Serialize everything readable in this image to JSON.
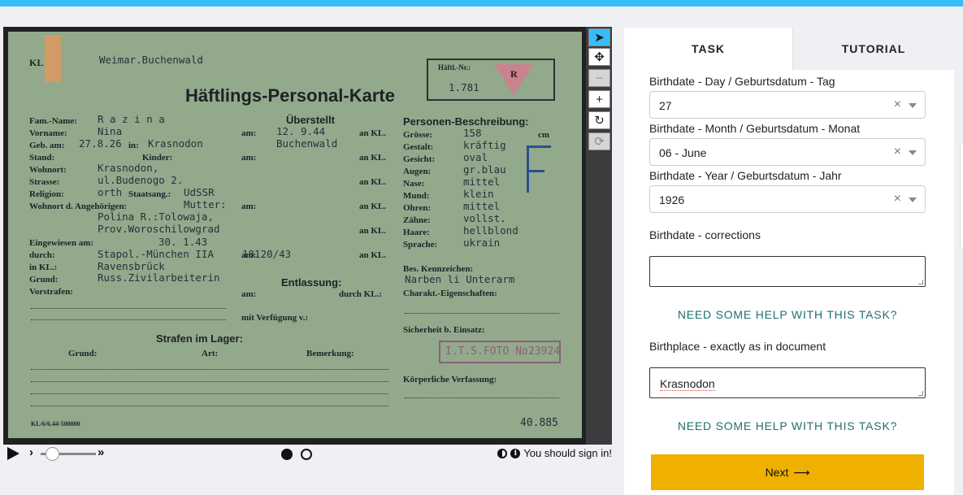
{
  "viewer": {
    "card": {
      "camp": "Weimar.Buchenwald",
      "kl": "KL",
      "hnr_label": "Häftl.-Nr.:",
      "hnr_value": "1.781",
      "triangle_letter": "R",
      "title": "Häftlings-Personal-Karte",
      "fam_name_label": "Fam.-Name:",
      "fam_name": "R a z i n a",
      "vorname_label": "Vorname:",
      "vorname": "Nina",
      "geb_label": "Geb. am:",
      "geb_value": "27.8.26",
      "in_label": "in:",
      "geb_place": "Krasnodon",
      "stand_label": "Stand:",
      "kinder_label": "Kinder:",
      "wohnort_label": "Wohnort:",
      "wohnort": "Krasnodon,",
      "strasse_label": "Strasse:",
      "strasse": "ul.Budenogo 2.",
      "religion_label": "Religion:",
      "religion": "orth",
      "staatsang_label": "Staatsang.:",
      "staatsang": "UdSSR",
      "angehoerige_label": "Wohnort d. Angehörigen:",
      "angehoerige_1": "Mutter:",
      "angehoerige_2": "Polina R.:Tolowaja,",
      "angehoerige_3": "Prov.Woroschilowgrad",
      "eingewiesen_label": "Eingewiesen am:",
      "eingewiesen": "30. 1.43",
      "durch_label": "durch:",
      "durch": "Stapol.-München IIA",
      "durch_nr": "18120/43",
      "inkl_label": "in KL.:",
      "inkl": "Ravensbrück",
      "grund_label": "Grund:",
      "grund": "Russ.Zivilarbeiterin",
      "vorstrafen_label": "Vorstrafen:",
      "ueberstellt_label": "Überstellt",
      "am_label": "am:",
      "ankl_label": "an KL.",
      "ueberstellt_date": "12. 9.44",
      "ueberstellt_place": "Buchenwald",
      "entlassung_label": "Entlassung:",
      "durchkl_label": "durch KL.:",
      "verfuegung_label": "mit Verfügung v.:",
      "personen_label": "Personen-Beschreibung:",
      "groesse_label": "Grösse:",
      "groesse": "158",
      "cm_label": "cm",
      "gestalt_label": "Gestalt:",
      "gestalt": "kräftig",
      "gesicht_label": "Gesicht:",
      "gesicht": "oval",
      "augen_label": "Augen:",
      "augen": "gr.blau",
      "nase_label": "Nase:",
      "nase": "mittel",
      "mund_label": "Mund:",
      "mund": "klein",
      "ohren_label": "Ohren:",
      "ohren": "mittel",
      "zaehne_label": "Zähne:",
      "zaehne": "vollst.",
      "haare_label": "Haare:",
      "haare": "hellblond",
      "sprache_label": "Sprache:",
      "sprache": "ukrain",
      "kennzeichen_label": "Bes. Kennzeichen:",
      "kennzeichen": "Narben li Unterarm",
      "charakt_label": "Charakt.-Eigenschaften:",
      "sicherheit_label": "Sicherheit b. Einsatz:",
      "koerper_label": "Körperliche Verfassung:",
      "stamp": "I.T.S.FOTO No.",
      "stamp_nr": "23924",
      "strafen_label": "Strafen im Lager:",
      "grund_col": "Grund:",
      "art_col": "Art:",
      "bemerkung_col": "Bemerkung:",
      "footer_left": "KL/6/6.44-500000",
      "footer_right": "40.885",
      "pen_letter": "F"
    },
    "tools": [
      "pointer-icon",
      "move-icon",
      "zoom-out-icon",
      "zoom-in-icon",
      "rotate-icon",
      "refresh-icon"
    ]
  },
  "player": {
    "sign_in": "You should sign in!"
  },
  "panel": {
    "tabs": [
      {
        "label": "TASK",
        "active": true
      },
      {
        "label": "TUTORIAL",
        "active": false
      }
    ],
    "day_label": "Birthdate - Day / Geburtsdatum - Tag",
    "day_value": "27",
    "month_label": "Birthdate - Month / Geburtsdatum - Monat",
    "month_value": "06 - June",
    "year_label": "Birthdate - Year / Geburtsdatum - Jahr",
    "year_value": "1926",
    "clear_symbol": "×",
    "corrections_label": "Birthdate - corrections",
    "corrections_value": "",
    "help_1": "NEED SOME HELP WITH THIS TASK?",
    "birthplace_label": "Birthplace - exactly as in document",
    "birthplace_value": "Krasnodon",
    "help_2": "NEED SOME HELP WITH THIS TASK?",
    "next_label": "Next",
    "next_arrow": "⟶"
  },
  "colors": {
    "accent": "#38bdf8",
    "next_button": "#efb000",
    "help_link": "#1f6f6f"
  }
}
